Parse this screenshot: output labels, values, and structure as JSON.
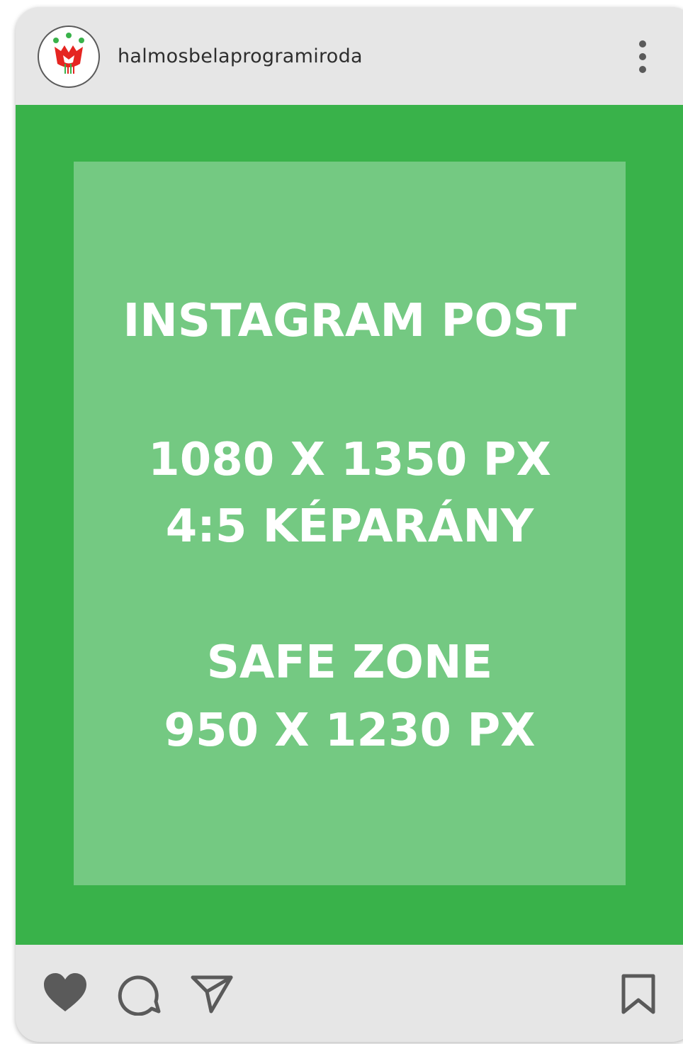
{
  "post": {
    "username": "halmosbelaprogramiroda",
    "avatar_icon": "tulip-crown-logo",
    "menu_icon": "more-vertical-icon",
    "media": {
      "title": "INSTAGRAM POST",
      "dimensions": "1080 X 1350 PX",
      "aspect_ratio": "4:5 KÉPARÁNY",
      "safe_zone_label": "SAFE ZONE",
      "safe_zone_dimensions": "950 X 1230 PX"
    },
    "actions": {
      "like_icon": "heart-icon",
      "comment_icon": "comment-icon",
      "share_icon": "send-icon",
      "save_icon": "bookmark-icon"
    }
  },
  "colors": {
    "card_background": "#e6e6e6",
    "media_green": "#39b24a",
    "safe_zone_green": "#74c982",
    "icon_gray": "#5a5a5a",
    "text_white": "#ffffff"
  }
}
